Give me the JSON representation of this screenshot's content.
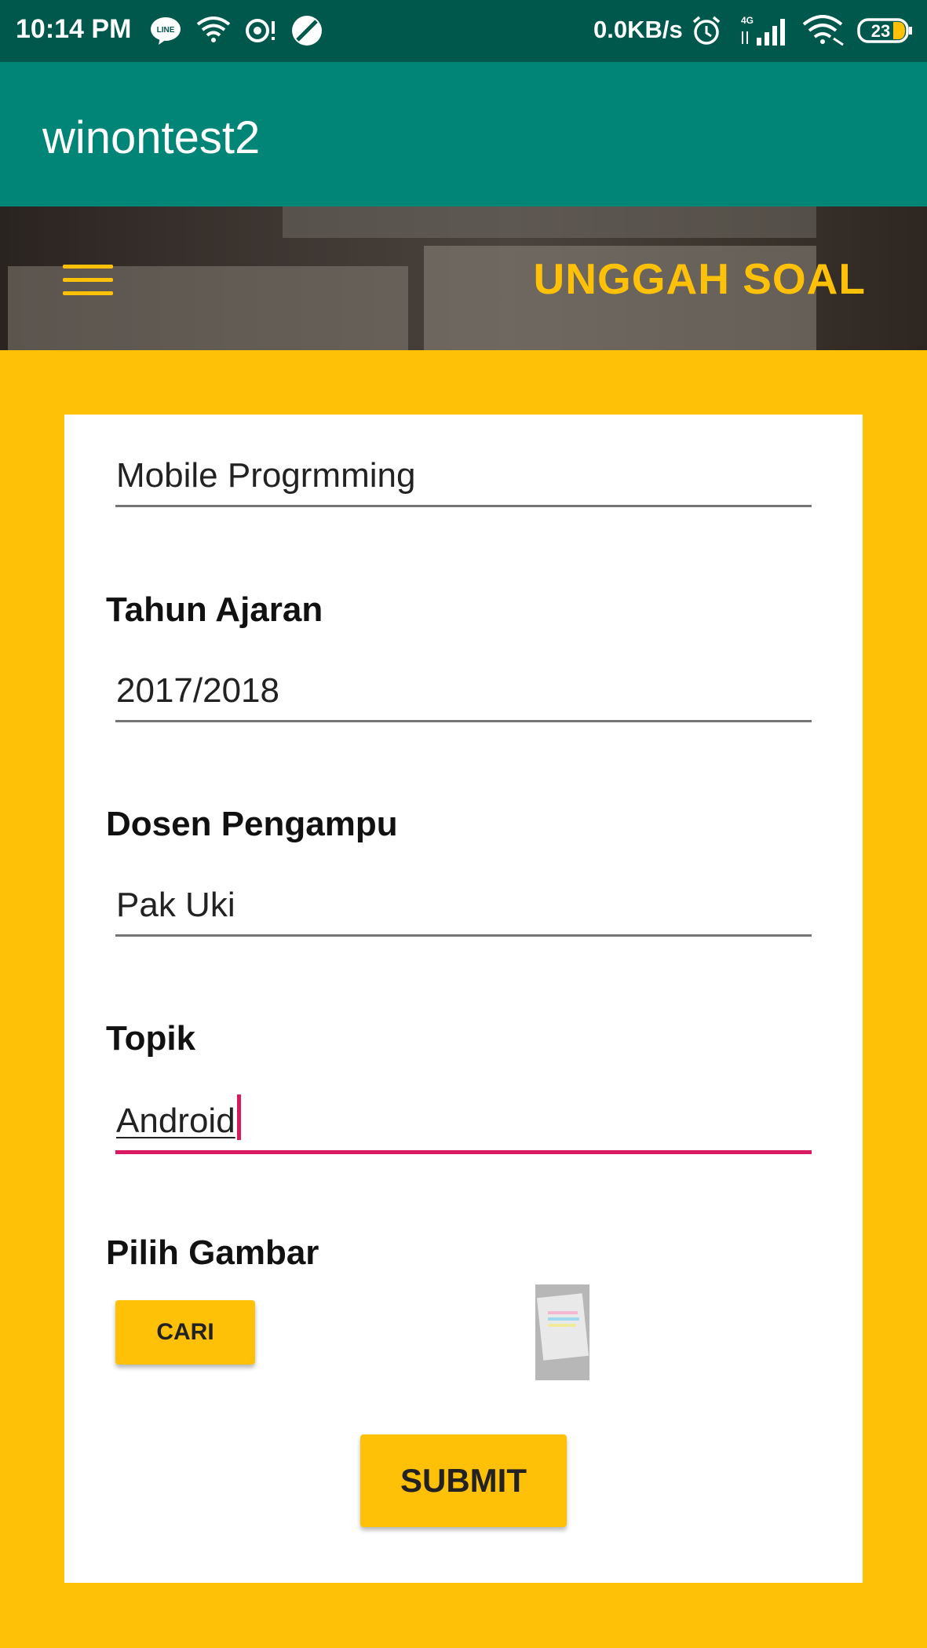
{
  "status_bar": {
    "time": "10:14 PM",
    "left_icons": [
      "line-icon",
      "wifi-call-icon",
      "hotspot-icon",
      "blocked-icon"
    ],
    "network_speed": "0.0KB/s",
    "signal_label": "4G",
    "battery": "23",
    "right_icons": [
      "alarm-icon",
      "signal-icon",
      "wifi-icon",
      "battery-icon"
    ]
  },
  "app_bar": {
    "title": "winontest2"
  },
  "header": {
    "title": "UNGGAH SOAL",
    "menu_icon": "hamburger-menu-icon"
  },
  "form": {
    "mata_kuliah_value": "Mobile Progrmming",
    "tahun_ajaran_label": "Tahun Ajaran",
    "tahun_ajaran_value": "2017/2018",
    "dosen_label": "Dosen Pengampu",
    "dosen_value": "Pak Uki",
    "topik_label": "Topik",
    "topik_value": "Android",
    "gambar_label": "Pilih Gambar",
    "cari_button": "CARI",
    "submit_button": "SUBMIT"
  },
  "colors": {
    "status_bar": "#00574B",
    "app_bar": "#008577",
    "accent": "#FFC107",
    "focus": "#D81B60"
  }
}
